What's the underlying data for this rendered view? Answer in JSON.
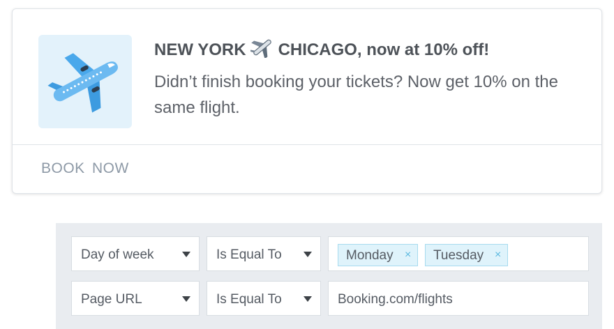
{
  "notification": {
    "title_from": "NEW YORK",
    "title_to": "CHICAGO, now at 10% off!",
    "message": "Didn’t finish booking your tickets? Now get 10% on the same flight.",
    "action_label": "BOOK  NOW"
  },
  "rules": [
    {
      "field": "Day of week",
      "operator": "Is Equal To",
      "tags": [
        {
          "label": "Monday",
          "remove": "×"
        },
        {
          "label": "Tuesday",
          "remove": "×"
        }
      ]
    },
    {
      "field": "Page URL",
      "operator": "Is Equal To",
      "value": "Booking.com/flights"
    }
  ],
  "icons": {
    "thumbnail": "airplane-icon",
    "title_separator": "airplane-icon",
    "dropdown": "caret-down-icon",
    "tag_remove": "close-icon"
  },
  "colors": {
    "thumbnail_bg": "#e3f2fb",
    "plane_blue": "#5fb3ef",
    "tag_bg": "#dff3fb",
    "tag_border": "#a6dbef",
    "rules_bg": "#e9ecf0",
    "action_text": "#8d99a6"
  }
}
